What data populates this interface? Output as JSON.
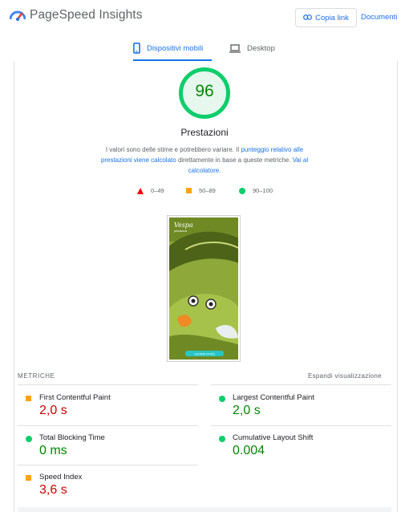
{
  "header": {
    "title": "PageSpeed Insights",
    "copy_label": "Copia link",
    "docs_label": "Documenti"
  },
  "tabs": {
    "mobile": "Dispositivi mobili",
    "desktop": "Desktop"
  },
  "score": {
    "value": "96",
    "label": "Prestazioni",
    "color": "#0cce6b"
  },
  "description": {
    "text1": "I valori sono delle stime e potrebbero variare. Il ",
    "link1": "punteggio relativo alle prestazioni viene calcolato",
    "text2": " direttamente in base a queste metriche. ",
    "link2": "Vai al calcolatore."
  },
  "legend": {
    "poor": "0–49",
    "average": "50–89",
    "good": "90–100"
  },
  "screenshot": {
    "brand": "Vespa",
    "brand_sub": "primavera",
    "cta": "SCOPRI DI PIÙ"
  },
  "metrics": {
    "title": "METRICHE",
    "expand": "Espandi visualizzazione",
    "fcp": {
      "name": "First Contentful Paint",
      "value": "2,0 s"
    },
    "lcp": {
      "name": "Largest Contentful Paint",
      "value": "2,0 s"
    },
    "tbt": {
      "name": "Total Blocking Time",
      "value": "0 ms"
    },
    "cls": {
      "name": "Cumulative Layout Shift",
      "value": "0.004"
    },
    "si": {
      "name": "Speed Index",
      "value": "3,6 s"
    }
  }
}
